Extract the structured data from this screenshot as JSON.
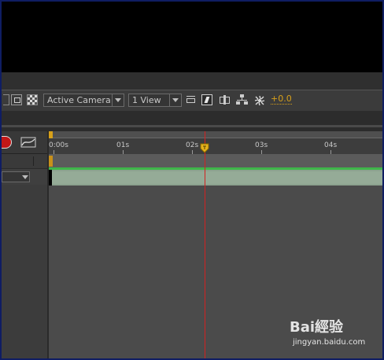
{
  "toolbar": {
    "camera_view": "Active Camera",
    "view_layout": "1 View",
    "exposure_value": "+0.0",
    "accent_color": "#d7a01a"
  },
  "timeline": {
    "ruler_labels": [
      "0:00s",
      "01s",
      "02s",
      "03s",
      "04s"
    ],
    "current_time_marker_color": "#d32121",
    "layer_bar_color": "#8ca38f",
    "work_area_color": "#3fb64a"
  },
  "icons": {
    "toolbar": [
      "region-of-interest-icon",
      "transparency-grid-icon",
      "fast-previews-icon",
      "timeline-icon",
      "comp-flowchart-icon",
      "exposure-reset-icon"
    ],
    "timeline_header": [
      "motion-blur-icon",
      "graph-editor-icon"
    ]
  },
  "watermark": {
    "logo_text": "Bai經验",
    "url": "jingyan.baidu.com"
  }
}
